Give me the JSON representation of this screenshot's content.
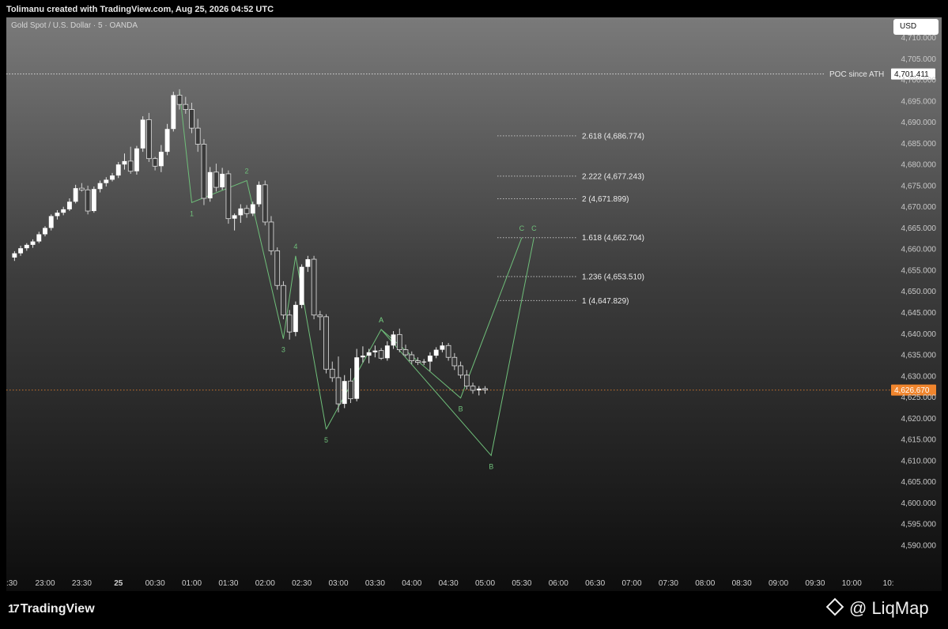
{
  "header": {
    "attribution": "Tolimanu created with TradingView.com, Aug 25, 2026 04:52 UTC"
  },
  "symbol_label": "Gold Spot / U.S. Dollar · 5 · OANDA",
  "currency_button": "USD",
  "footer": {
    "tv_brand": "TradingView",
    "tv_mark": "17",
    "watermark": "@ LiqMap"
  },
  "colors": {
    "wave": "#6fbf7a",
    "bull": "#ffffff",
    "bear": "#3a3a3a",
    "last_price": "#f0852d"
  },
  "chart_data": {
    "type": "candlestick",
    "y_axis": {
      "range": [
        4587,
        4714
      ],
      "ticks": [
        "4,710.000",
        "4,705.000",
        "4,700.000",
        "4,695.000",
        "4,690.000",
        "4,685.000",
        "4,680.000",
        "4,675.000",
        "4,670.000",
        "4,665.000",
        "4,660.000",
        "4,655.000",
        "4,650.000",
        "4,645.000",
        "4,640.000",
        "4,635.000",
        "4,630.000",
        "4,625.000",
        "4,620.000",
        "4,615.000",
        "4,610.000",
        "4,605.000",
        "4,600.000",
        "4,595.000",
        "4,590.000"
      ],
      "tick_values": [
        4710,
        4705,
        4700,
        4695,
        4690,
        4685,
        4680,
        4675,
        4670,
        4665,
        4660,
        4655,
        4650,
        4645,
        4640,
        4635,
        4630,
        4625,
        4620,
        4615,
        4610,
        4605,
        4600,
        4595,
        4590
      ]
    },
    "x_axis": {
      "labels": [
        ":30",
        "23:00",
        "23:30",
        "25",
        "00:30",
        "01:00",
        "01:30",
        "02:00",
        "02:30",
        "03:00",
        "03:30",
        "04:00",
        "04:30",
        "05:00",
        "05:30",
        "06:00",
        "06:30",
        "07:00",
        "07:30",
        "08:00",
        "08:30",
        "09:00",
        "09:30",
        "10:00",
        "10:"
      ],
      "bold": [
        "25"
      ]
    },
    "candles_start": "22:35",
    "candle_interval_minutes": 5,
    "candles": [
      [
        4658.0,
        4659.5,
        4657.2,
        4659.0
      ],
      [
        4659.0,
        4660.8,
        4658.4,
        4660.2
      ],
      [
        4660.2,
        4661.4,
        4659.6,
        4661.0
      ],
      [
        4661.0,
        4662.3,
        4660.3,
        4661.8
      ],
      [
        4661.8,
        4664.1,
        4661.4,
        4663.5
      ],
      [
        4663.5,
        4665.4,
        4663.0,
        4665.0
      ],
      [
        4665.0,
        4668.2,
        4664.4,
        4667.8
      ],
      [
        4667.8,
        4669.2,
        4667.0,
        4668.6
      ],
      [
        4668.6,
        4670.0,
        4668.0,
        4669.4
      ],
      [
        4669.4,
        4672.0,
        4669.0,
        4671.2
      ],
      [
        4671.2,
        4675.2,
        4670.8,
        4674.4
      ],
      [
        4674.4,
        4675.6,
        4673.6,
        4674.0
      ],
      [
        4674.0,
        4675.0,
        4668.2,
        4669.0
      ],
      [
        4669.0,
        4674.8,
        4668.6,
        4674.2
      ],
      [
        4674.2,
        4676.2,
        4673.4,
        4675.6
      ],
      [
        4675.6,
        4677.0,
        4674.8,
        4676.4
      ],
      [
        4676.4,
        4678.0,
        4676.0,
        4677.4
      ],
      [
        4677.4,
        4680.6,
        4676.8,
        4680.0
      ],
      [
        4680.0,
        4682.6,
        4678.8,
        4680.8
      ],
      [
        4680.8,
        4684.2,
        4677.8,
        4678.4
      ],
      [
        4678.4,
        4684.4,
        4677.6,
        4683.8
      ],
      [
        4683.8,
        4691.4,
        4683.0,
        4690.6
      ],
      [
        4690.6,
        4692.2,
        4680.6,
        4681.4
      ],
      [
        4681.4,
        4681.8,
        4678.6,
        4679.6
      ],
      [
        4679.6,
        4684.6,
        4678.2,
        4683.0
      ],
      [
        4683.0,
        4689.6,
        4682.2,
        4688.4
      ],
      [
        4688.4,
        4697.2,
        4687.8,
        4696.4
      ],
      [
        4696.4,
        4697.8,
        4693.0,
        4694.2
      ],
      [
        4694.2,
        4696.0,
        4692.0,
        4693.0
      ],
      [
        4693.0,
        4694.6,
        4687.4,
        4688.6
      ],
      [
        4688.6,
        4690.8,
        4683.0,
        4684.8
      ],
      [
        4684.8,
        4686.0,
        4670.4,
        4672.0
      ],
      [
        4672.0,
        4679.4,
        4671.2,
        4678.2
      ],
      [
        4678.2,
        4680.2,
        4673.6,
        4674.6
      ],
      [
        4674.6,
        4679.2,
        4674.0,
        4677.8
      ],
      [
        4677.8,
        4678.6,
        4666.0,
        4667.2
      ],
      [
        4667.2,
        4668.4,
        4664.4,
        4668.0
      ],
      [
        4668.0,
        4670.6,
        4666.2,
        4669.6
      ],
      [
        4669.6,
        4670.4,
        4667.4,
        4668.4
      ],
      [
        4668.4,
        4671.2,
        4667.8,
        4670.6
      ],
      [
        4670.6,
        4676.0,
        4670.0,
        4675.2
      ],
      [
        4675.2,
        4676.2,
        4665.6,
        4666.4
      ],
      [
        4666.4,
        4667.8,
        4658.6,
        4659.6
      ],
      [
        4659.6,
        4660.4,
        4650.4,
        4651.4
      ],
      [
        4651.4,
        4652.4,
        4643.4,
        4644.4
      ],
      [
        4644.4,
        4645.6,
        4638.6,
        4640.4
      ],
      [
        4640.4,
        4647.6,
        4639.4,
        4646.8
      ],
      [
        4646.8,
        4656.4,
        4646.0,
        4655.8
      ],
      [
        4655.8,
        4658.4,
        4654.6,
        4657.6
      ],
      [
        4657.6,
        4658.4,
        4643.4,
        4644.4
      ],
      [
        4644.4,
        4645.4,
        4640.8,
        4644.0
      ],
      [
        4644.0,
        4644.6,
        4630.6,
        4631.6
      ],
      [
        4631.6,
        4633.4,
        4628.6,
        4629.6
      ],
      [
        4629.6,
        4634.6,
        4621.4,
        4623.4
      ],
      [
        4623.4,
        4630.2,
        4622.4,
        4628.8
      ],
      [
        4628.8,
        4631.8,
        4623.6,
        4624.6
      ],
      [
        4624.6,
        4636.4,
        4624.0,
        4634.4
      ],
      [
        4634.4,
        4637.0,
        4633.2,
        4634.8
      ],
      [
        4634.8,
        4636.4,
        4633.0,
        4635.6
      ],
      [
        4635.6,
        4637.2,
        4634.4,
        4636.0
      ],
      [
        4636.0,
        4636.6,
        4633.8,
        4634.2
      ],
      [
        4634.2,
        4638.2,
        4633.6,
        4637.2
      ],
      [
        4637.2,
        4640.6,
        4636.4,
        4639.8
      ],
      [
        4639.8,
        4641.2,
        4635.6,
        4636.2
      ],
      [
        4636.2,
        4637.4,
        4634.6,
        4635.0
      ],
      [
        4635.0,
        4635.8,
        4632.8,
        4633.6
      ],
      [
        4633.6,
        4634.4,
        4632.6,
        4633.2
      ],
      [
        4633.2,
        4634.0,
        4632.6,
        4633.4
      ],
      [
        4633.4,
        4635.6,
        4631.2,
        4634.8
      ],
      [
        4634.8,
        4636.8,
        4634.2,
        4636.2
      ],
      [
        4636.2,
        4638.0,
        4635.6,
        4637.2
      ],
      [
        4637.2,
        4637.8,
        4633.6,
        4634.4
      ],
      [
        4634.4,
        4635.4,
        4631.4,
        4632.4
      ],
      [
        4632.4,
        4633.4,
        4629.4,
        4630.2
      ],
      [
        4630.2,
        4631.4,
        4626.8,
        4627.6
      ],
      [
        4627.6,
        4628.4,
        4625.8,
        4626.6
      ],
      [
        4626.6,
        4627.6,
        4625.4,
        4627.0
      ],
      [
        4627.0,
        4627.6,
        4625.8,
        4626.7
      ]
    ],
    "poc_line": {
      "label": "POC since ATH",
      "value_label": "4,701.411",
      "value": 4701.411
    },
    "last_price": {
      "value_label": "4,626.670",
      "value": 4626.67
    },
    "fib_levels": [
      {
        "label": "2.618 (4,686.774)",
        "value": 4686.774
      },
      {
        "label": "2.222 (4,677.243)",
        "value": 4677.243
      },
      {
        "label": "2 (4,671.899)",
        "value": 4671.899
      },
      {
        "label": "1.618 (4,662.704)",
        "value": 4662.704
      },
      {
        "label": "1.236 (4,653.510)",
        "value": 4653.51
      },
      {
        "label": "1 (4,647.829)",
        "value": 4647.829
      }
    ],
    "impulse_wave": [
      {
        "label": "",
        "time": "00:50",
        "price": 4697.5
      },
      {
        "label": "1",
        "time": "01:00",
        "price": 4671.0
      },
      {
        "label": "2",
        "time": "01:45",
        "price": 4676.2
      },
      {
        "label": "3",
        "time": "02:15",
        "price": 4638.8
      },
      {
        "label": "4",
        "time": "02:25",
        "price": 4658.4
      },
      {
        "label": "5",
        "time": "02:50",
        "price": 4617.4
      }
    ],
    "correction_paths": [
      [
        {
          "label": "5",
          "time": "02:50",
          "price": 4617.4
        },
        {
          "label": "A",
          "time": "03:35",
          "price": 4641.0
        },
        {
          "label": "B",
          "time": "04:40",
          "price": 4624.8
        },
        {
          "label": "C",
          "time": "05:30",
          "price": 4662.7
        }
      ],
      [
        {
          "label": "A",
          "time": "03:35",
          "price": 4641.0
        },
        {
          "label": "B",
          "time": "05:05",
          "price": 4611.2
        },
        {
          "label": "C",
          "time": "05:40",
          "price": 4662.7
        }
      ]
    ]
  }
}
